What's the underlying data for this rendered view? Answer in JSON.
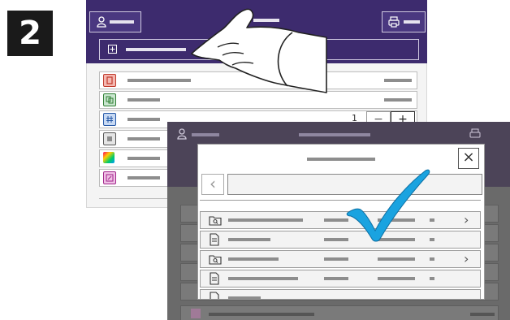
{
  "step": {
    "number": "2"
  },
  "back_screen": {
    "counter_value": "1",
    "stepper": {
      "minus": "−",
      "plus": "+"
    },
    "app_icons": [
      "doc-red-icon",
      "copy-icon",
      "hash-icon",
      "list-icon",
      "rainbow-icon",
      "scan-icon"
    ]
  },
  "dialog": {
    "close_label": "×",
    "back_label": "‹",
    "chevron": "›"
  },
  "colors": {
    "header_purple": "#3d2b6e",
    "check_blue": "#1aa3e0",
    "dim_gray": "#6a6a6a"
  }
}
